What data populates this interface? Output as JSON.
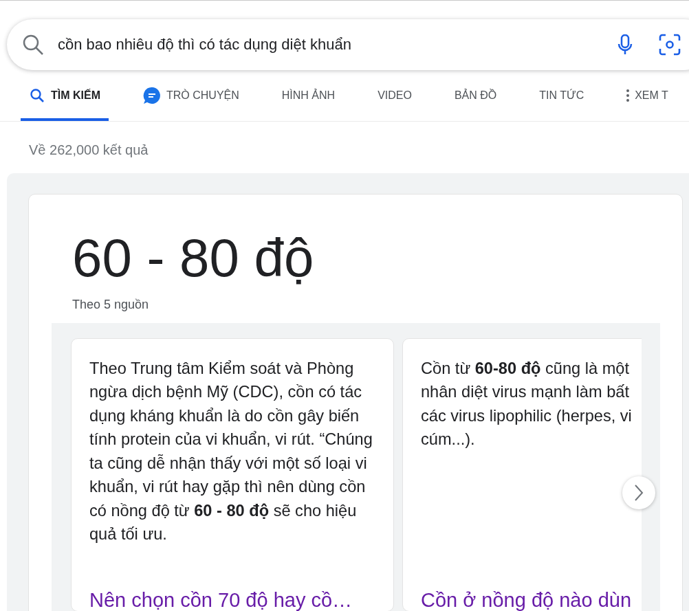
{
  "search": {
    "value": "cồn bao nhiêu độ thì có tác dụng diệt khuẩn"
  },
  "tabs": [
    {
      "label": "TÌM KIẾM",
      "kind": "search",
      "selected": true
    },
    {
      "label": "TRÒ CHUYỆN",
      "kind": "chat",
      "selected": false
    },
    {
      "label": "HÌNH ẢNH",
      "kind": "plain",
      "selected": false
    },
    {
      "label": "VIDEO",
      "kind": "plain",
      "selected": false
    },
    {
      "label": "BẢN ĐỒ",
      "kind": "plain",
      "selected": false
    },
    {
      "label": "TIN TỨC",
      "kind": "plain",
      "selected": false
    },
    {
      "label": "XEM T",
      "kind": "more",
      "selected": false
    }
  ],
  "result_count": "Về 262,000 kết quả",
  "answer": {
    "value": "60 - 80 độ",
    "sources": "Theo 5 nguồn",
    "cards": [
      {
        "text": "Theo Trung tâm Kiểm soát và Phòng ngừa dịch bệnh Mỹ (CDC), cồn có tác dụng kháng khuẩn là do cồn gây biến tính protein của vi khuẩn, vi rút. “Chúng ta cũng dễ nhận thấy với một số loại vi khuẩn, vi rút hay gặp thì nên dùng cồn có nồng độ từ **60 - 80 độ** sẽ cho hiệu quả tối ưu.",
        "link": "Nên chọn cồn 70 độ hay cồ…"
      },
      {
        "text": "Cồn từ **60-80 độ** cũng là một\nnhân diệt virus mạnh làm bất\ncác virus lipophilic (herpes, vi\ncúm...).",
        "link": "Cồn ở nồng độ nào dùn"
      }
    ]
  }
}
